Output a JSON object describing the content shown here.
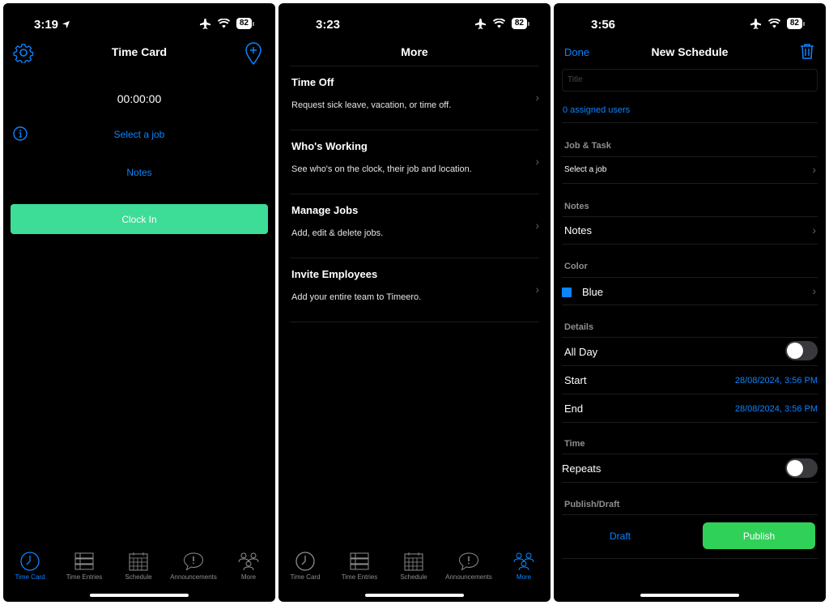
{
  "panel1": {
    "status_time": "3:19",
    "battery": "82",
    "title": "Time Card",
    "timer": "00:00:00",
    "select_job": "Select a job",
    "notes": "Notes",
    "clock_in": "Clock In"
  },
  "panel2": {
    "status_time": "3:23",
    "battery": "82",
    "title": "More",
    "items": [
      {
        "title": "Time Off",
        "subtitle": "Request sick leave, vacation, or time off."
      },
      {
        "title": "Who's Working",
        "subtitle": "See who's on the clock, their job and location."
      },
      {
        "title": "Manage Jobs",
        "subtitle": "Add, edit & delete jobs."
      },
      {
        "title": "Invite Employees",
        "subtitle": "Add your entire team to Timeero."
      }
    ]
  },
  "panel3": {
    "status_time": "3:56",
    "battery": "82",
    "done": "Done",
    "title": "New Schedule",
    "title_placeholder": "Title",
    "assigned_users": "0 assigned users",
    "job_task_header": "Job & Task",
    "select_job": "Select a job",
    "notes_header": "Notes",
    "notes_row": "Notes",
    "color_header": "Color",
    "color_value": "Blue",
    "color_swatch": "#0a84ff",
    "details_header": "Details",
    "all_day": "All Day",
    "start_label": "Start",
    "start_value": "28/08/2024, 3:56 PM",
    "end_label": "End",
    "end_value": "28/08/2024, 3:56 PM",
    "time_header": "Time",
    "repeats": "Repeats",
    "publish_header": "Publish/Draft",
    "draft": "Draft",
    "publish": "Publish"
  },
  "tabs": [
    {
      "label": "Time Card",
      "icon": "clock-icon"
    },
    {
      "label": "Time Entries",
      "icon": "list-icon"
    },
    {
      "label": "Schedule",
      "icon": "calendar-icon"
    },
    {
      "label": "Announcements",
      "icon": "speech-bubble-icon"
    },
    {
      "label": "More",
      "icon": "people-icon"
    }
  ],
  "colors": {
    "accent": "#0a84ff",
    "clock_in_green": "#3ddc97",
    "publish_green": "#30d158",
    "inactive_tab": "#8e8e93"
  }
}
